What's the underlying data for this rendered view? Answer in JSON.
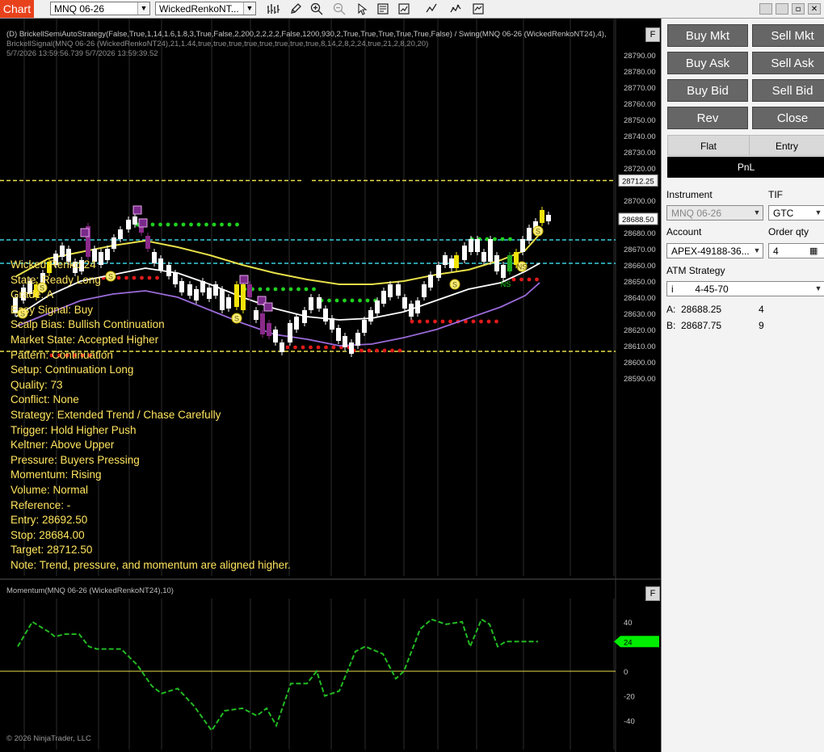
{
  "toolbar": {
    "app_tab": "Chart",
    "instrument": "MNQ 06-26",
    "bar_type": "WickedRenkoNT...",
    "icons": [
      "bar-style-icon",
      "draw-pencil-icon",
      "zoom-in-icon",
      "zoom-out-icon",
      "pointer-icon",
      "data-box-icon",
      "indicators-icon",
      "strategies-icon",
      "properties-icon"
    ],
    "window_controls": [
      "minimize-icon",
      "restore-icon",
      "maximize-icon",
      "close-icon"
    ]
  },
  "chart": {
    "strategy_label_1": "(D) BrickellSemiAutoStrategy(False,True,1,14,1.6,1.8,3,True,False,2,200,2,2,2,2,False,1200,930,2,True,True,True,True,True,False) / Swing(MNQ 06-26 (WickedRenkoNT24),4),",
    "strategy_label_2": "BrickellSignal(MNQ 06-26 (WickedRenkoNT24),21,1.44,true,true,true,true,true,true,true,true,8,14,2,8,2,24,true,21,2,8,20,20)",
    "strategy_label_3": "5/7/2026 13:59:56.739 5/7/2026 13:59:39.52",
    "price_levels": [
      "28790.00",
      "28780.00",
      "28770.00",
      "28760.00",
      "28750.00",
      "28740.00",
      "28730.00",
      "28720.00",
      "28700.00",
      "28680.00",
      "28670.00",
      "28660.00",
      "28650.00",
      "28640.00",
      "28630.00",
      "28620.00",
      "28610.00",
      "28600.00",
      "28590.00"
    ],
    "target_tag": "28712.25",
    "last_price_tag": "28688.50",
    "overlay_lines": [
      "Wicked Renko 24",
      "State: Ready Long",
      "Grade: A",
      "Easy Signal: Buy",
      "Scalp Bias: Bullish Continuation",
      "Market State: Accepted Higher",
      "Pattern: Continuation",
      "Setup: Continuation Long",
      "Quality: 73",
      "Conflict: None",
      "Strategy: Extended Trend / Chase Carefully",
      "Trigger: Hold Higher Push",
      "Keltner: Above Upper",
      "Pressure: Buyers Pressing",
      "Momentum: Rising",
      "Volume: Normal",
      "Reference: -",
      "Entry: 28692.50",
      "Stop: 28684.00",
      "Target: 28712.50",
      "Note: Trend, pressure, and momentum are aligned higher."
    ],
    "markers": [
      "S",
      "S",
      "S",
      "S",
      "S",
      "S",
      "NS"
    ],
    "f_button": "F",
    "momentum_label": "Momentum(MNQ 06-26 (WickedRenkoNT24),10)",
    "momentum_levels": [
      "40",
      "0",
      "-20",
      "-40"
    ],
    "momentum_tag": "24",
    "copyright": "© 2026 NinjaTrader, LLC"
  },
  "panel": {
    "buy_mkt": "Buy Mkt",
    "sell_mkt": "Sell Mkt",
    "buy_ask": "Buy Ask",
    "sell_ask": "Sell Ask",
    "buy_bid": "Buy Bid",
    "sell_bid": "Sell Bid",
    "rev": "Rev",
    "close": "Close",
    "flat": "Flat",
    "entry": "Entry",
    "pnl": "PnL",
    "instrument_label": "Instrument",
    "instrument_value": "MNQ 06-26",
    "tif_label": "TIF",
    "tif_value": "GTC",
    "account_label": "Account",
    "account_value": "APEX-49188-36...",
    "qty_label": "Order qty",
    "qty_value": "4",
    "atm_label": "ATM Strategy",
    "atm_value": "4-45-70",
    "ask_label": "A:",
    "ask_price": "28688.25",
    "ask_size": "4",
    "bid_label": "B:",
    "bid_price": "28687.75",
    "bid_size": "9"
  },
  "colors": {
    "accent": "#e8421c",
    "overlay_text": "#ffe45e",
    "yellow_band": "#e8e04a",
    "purple_band": "#9a6ad8",
    "cyan_level": "#3ad0e0",
    "green_dot": "#1fd11f",
    "red_dot": "#e01a1a",
    "momentum": "#22bb22"
  }
}
